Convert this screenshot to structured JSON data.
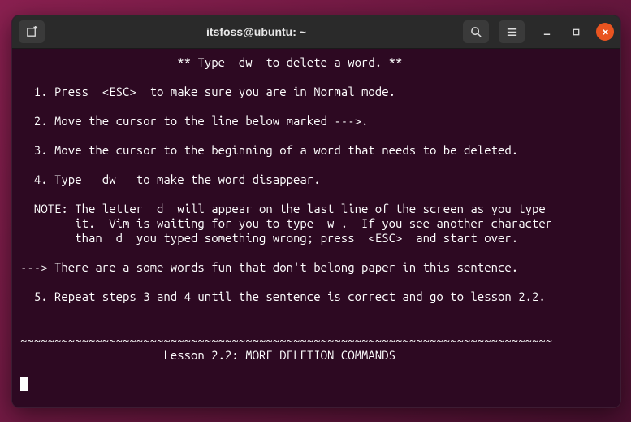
{
  "window": {
    "title": "itsfoss@ubuntu: ~"
  },
  "content": {
    "header": "                       ** Type  dw  to delete a word. **",
    "step1": "  1. Press  <ESC>  to make sure you are in Normal mode.",
    "step2": "  2. Move the cursor to the line below marked --->.",
    "step3": "  3. Move the cursor to the beginning of a word that needs to be deleted.",
    "step4": "  4. Type   dw   to make the word disappear.",
    "note1": "  NOTE: The letter  d  will appear on the last line of the screen as you type",
    "note2": "        it.  Vim is waiting for you to type  w .  If you see another character",
    "note3": "        than  d  you typed something wrong; press  <ESC>  and start over.",
    "example": "---> There are a some words fun that don't belong paper in this sentence.",
    "step5": "  5. Repeat steps 3 and 4 until the sentence is correct and go to lesson 2.2.",
    "divider": "~~~~~~~~~~~~~~~~~~~~~~~~~~~~~~~~~~~~~~~~~~~~~~~~~~~~~~~~~~~~~~~~~~~~~~~~~~~~~~",
    "lesson_title": "                     Lesson 2.2: MORE DELETION COMMANDS"
  }
}
